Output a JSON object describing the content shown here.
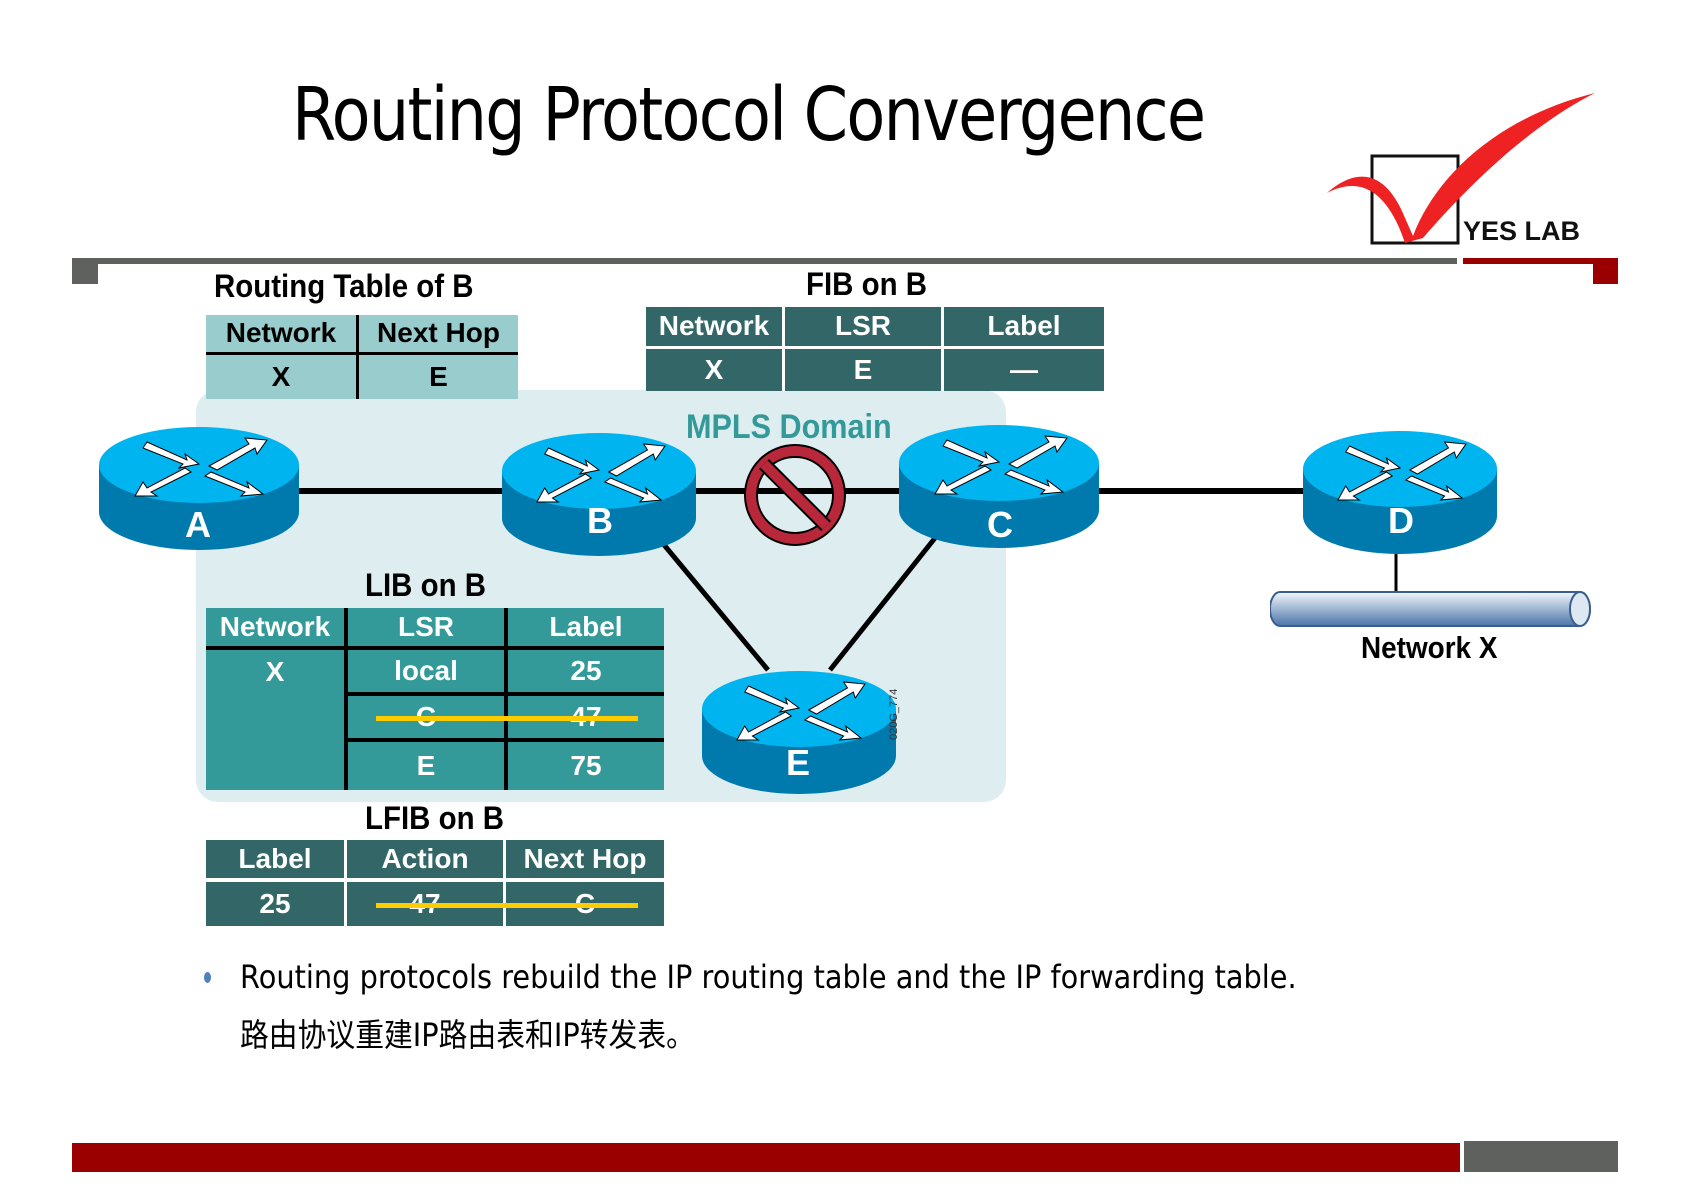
{
  "slide": {
    "title": "Routing Protocol Convergence",
    "logo_text": "YES LAB",
    "colors": {
      "accent_red": "#9b0000",
      "bar_gray": "#5f615e",
      "router_top": "#00b4f0",
      "router_side": "#0079ad",
      "domain_bg": "#deeef0",
      "mpls_text": "#339999",
      "prohibit": "#b8283a",
      "strike": "#ffcc00"
    }
  },
  "routing_table": {
    "title": "Routing Table of B",
    "headers": [
      "Network",
      "Next Hop"
    ],
    "rows": [
      [
        "X",
        "E"
      ]
    ]
  },
  "fib": {
    "title": "FIB on B",
    "headers": [
      "Network",
      "LSR",
      "Label"
    ],
    "rows": [
      [
        "X",
        "E",
        "—"
      ]
    ]
  },
  "lib": {
    "title": "LIB on B",
    "headers": [
      "Network",
      "LSR",
      "Label"
    ],
    "network": "X",
    "rows": [
      {
        "lsr": "local",
        "label": "25",
        "struck": false
      },
      {
        "lsr": "C",
        "label": "47",
        "struck": true
      },
      {
        "lsr": "E",
        "label": "75",
        "struck": false
      }
    ]
  },
  "lfib": {
    "title": "LFIB on B",
    "headers": [
      "Label",
      "Action",
      "Next Hop"
    ],
    "rows": [
      {
        "label": "25",
        "action": "47",
        "next_hop": "C",
        "struck": true
      }
    ]
  },
  "diagram": {
    "domain_label": "MPLS Domain",
    "routers": [
      "A",
      "B",
      "C",
      "D",
      "E"
    ],
    "network_label": "Network X",
    "figure_id": "020G_774",
    "links": [
      [
        "A",
        "B"
      ],
      [
        "B",
        "C"
      ],
      [
        "C",
        "D"
      ],
      [
        "B",
        "E"
      ],
      [
        "C",
        "E"
      ],
      [
        "D",
        "Network X"
      ]
    ],
    "broken_link": [
      "B",
      "C"
    ]
  },
  "bullets": [
    {
      "text": "Routing protocols rebuild the IP routing table and the IP forwarding  table.",
      "text_zh": "路由协议重建IP路由表和IP转发表。"
    }
  ]
}
